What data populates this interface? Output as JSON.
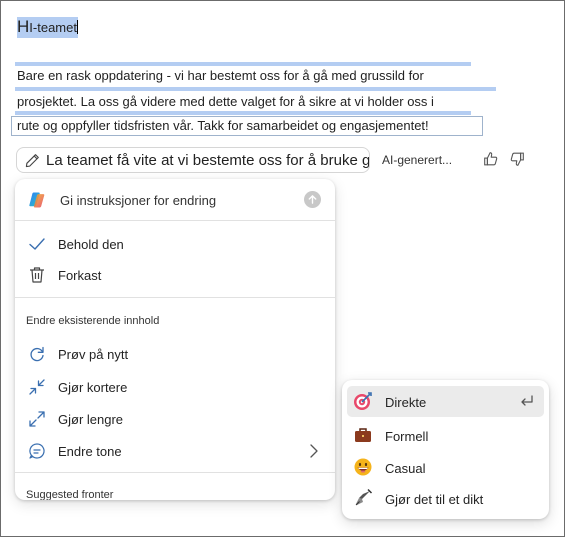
{
  "document": {
    "title_first": "H",
    "title_rest": "I-teamet",
    "body_lines": [
      "Bare en rask oppdatering - vi har bestemt oss for å gå med grussild for",
      "prosjektet. La oss gå videre med dette valget for å sikre at vi holder oss i",
      "rute og oppfyller tidsfristen vår. Takk for samarbeidet og engasjementet!"
    ]
  },
  "prompt": {
    "text": "La teamet få vite at vi bestemte oss for å bruke grussild for prosjektet",
    "ai_label": "AI-generert..."
  },
  "menu": {
    "input_placeholder": "Gi instruksjoner for endring",
    "keep_label": "Behold den",
    "discard_label": "Forkast",
    "section_label": "Endre eksisterende innhold",
    "retry_label": "Prøv på nytt",
    "shorter_label": "Gjør kortere",
    "longer_label": "Gjør lengre",
    "tone_label": "Endre tone",
    "suggested_label": "Suggested fronter"
  },
  "tone_menu": {
    "items": [
      {
        "label": "Direkte",
        "icon": "target-icon",
        "selected": true
      },
      {
        "label": "Formell",
        "icon": "briefcase-icon",
        "selected": false
      },
      {
        "label": "Casual",
        "icon": "grinning-face-icon",
        "selected": false
      },
      {
        "label": "Gjør det til et dikt",
        "icon": "fountain-pen-icon",
        "selected": false
      }
    ]
  },
  "colors": {
    "selection": "#b4cdf2",
    "accent_target": "#e8486a",
    "briefcase": "#8b3a1e",
    "emoji_face": "#f5b31b"
  }
}
